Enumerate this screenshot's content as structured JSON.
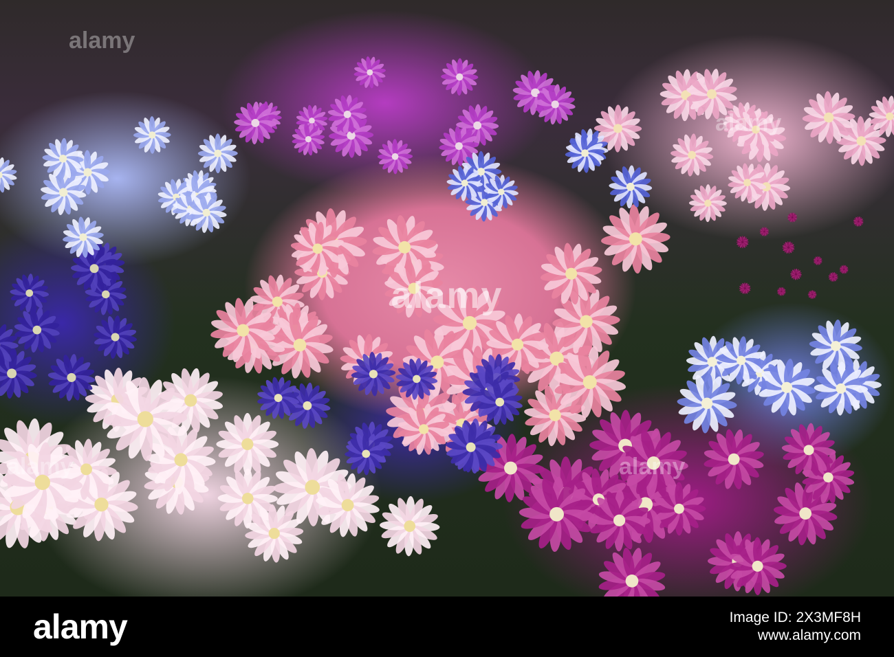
{
  "watermark": {
    "text": "alamy"
  },
  "footer": {
    "logo": "alamy",
    "image_id": "Image ID: 2X3MF8H",
    "site": "www.alamy.com"
  },
  "colors": {
    "pink_center": "#e68aa8",
    "light_pink": "#f0d4e2",
    "magenta": "#a01c86",
    "violet": "#3c2aa2",
    "lavender_blue": "#a7b4f0",
    "foliage": "#23301f"
  }
}
